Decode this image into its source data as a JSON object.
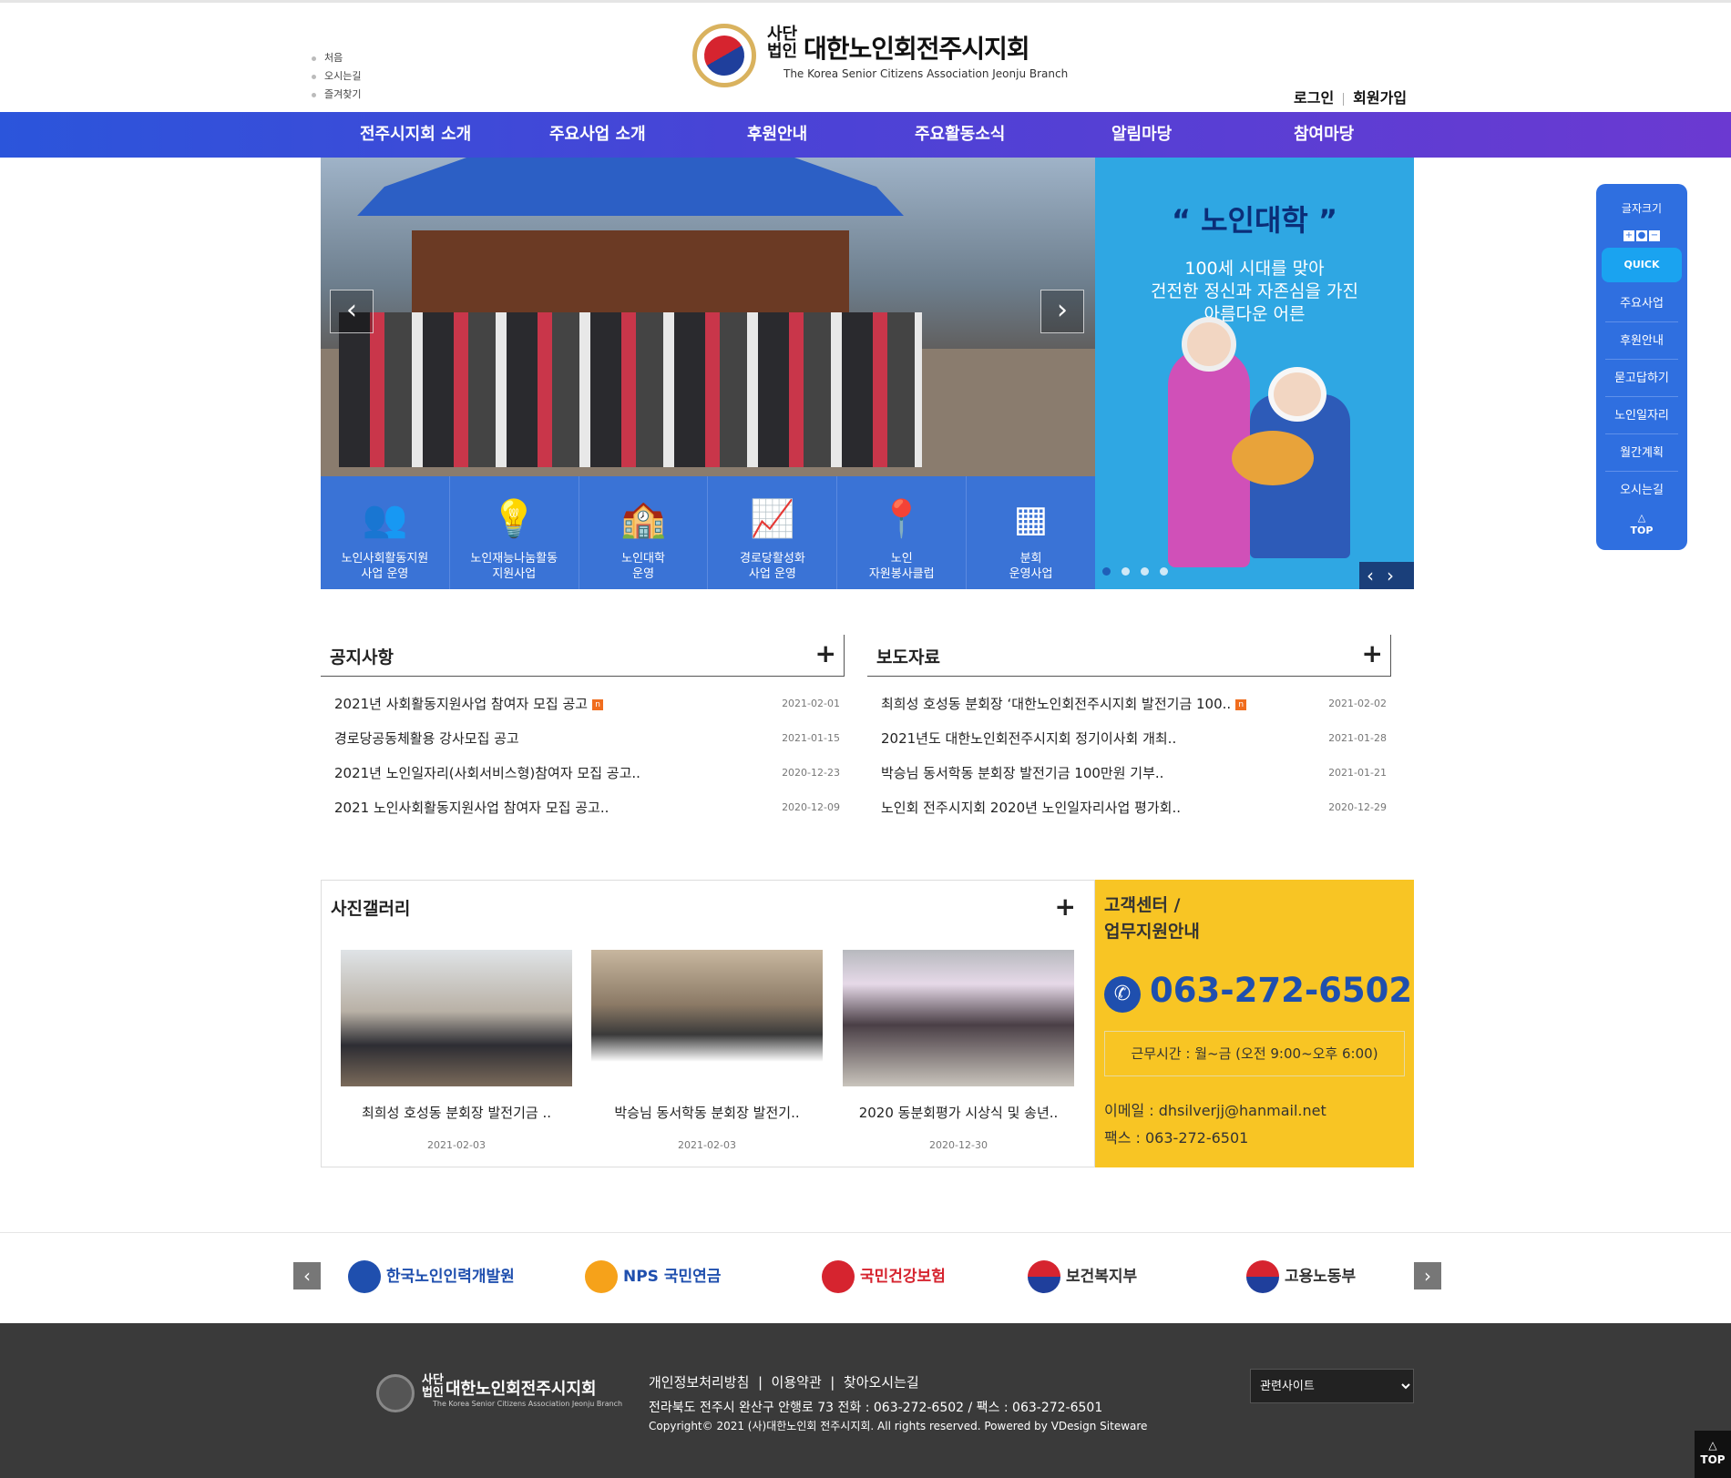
{
  "utility_links": [
    "처음",
    "오시는길",
    "즐겨찾기"
  ],
  "logo": {
    "small": "사단\n법인",
    "name": "대한노인회전주시지회",
    "english": "The Korea Senior Citizens Association Jeonju Branch"
  },
  "auth": {
    "login": "로그인",
    "join": "회원가입"
  },
  "nav": [
    "전주시지회 소개",
    "주요사업 소개",
    "후원안내",
    "주요활동소식",
    "알림마당",
    "참여마당"
  ],
  "slider": {
    "prev": "‹",
    "next": "›"
  },
  "promo": {
    "quote": "“ 노인대학 ”",
    "text_lines": [
      "100세 시대를 맞아",
      "건전한 정신과 자존심을 가진",
      "아름다운 어른"
    ]
  },
  "quick_services": [
    {
      "icon": "people-icon",
      "line1": "노인사회활동지원",
      "line2": "사업 운영"
    },
    {
      "icon": "lightbulb-icon",
      "line1": "노인재능나눔활동",
      "line2": "지원사업"
    },
    {
      "icon": "school-icon",
      "line1": "노인대학",
      "line2": "운영"
    },
    {
      "icon": "growth-chart-icon",
      "line1": "경로당활성화",
      "line2": "사업 운영"
    },
    {
      "icon": "map-pin-icon",
      "line1": "노인",
      "line2": "자원봉사클럽"
    },
    {
      "icon": "org-chart-icon",
      "line1": "분회",
      "line2": "운영사업"
    }
  ],
  "quick_panel": {
    "font_size": "글자크기",
    "quick": "QUICK",
    "items": [
      "주요사업",
      "후원안내",
      "묻고답하기",
      "노인일자리",
      "월간계획",
      "오시는길"
    ],
    "top_arrow": "△",
    "top": "TOP"
  },
  "notice": {
    "title": "공지사항",
    "more": "+",
    "items": [
      {
        "title": "2021년 사회활동지원사업 참여자 모집 공고",
        "date": "2021-02-01",
        "new": "n"
      },
      {
        "title": "경로당공동체활용 강사모집 공고",
        "date": "2021-01-15"
      },
      {
        "title": "2021년 노인일자리(사회서비스형)참여자 모집 공고..",
        "date": "2020-12-23"
      },
      {
        "title": "2021 노인사회활동지원사업 참여자 모집 공고..",
        "date": "2020-12-09"
      }
    ]
  },
  "press": {
    "title": "보도자료",
    "more": "+",
    "items": [
      {
        "title": "최희성 호성동 분회장 ‘대한노인회전주시지회 발전기금 100..",
        "date": "2021-02-02",
        "new": "n"
      },
      {
        "title": "2021년도 대한노인회전주시지회 정기이사회 개최..",
        "date": "2021-01-28"
      },
      {
        "title": "박승님 동서학동 분회장 발전기금 100만원 기부..",
        "date": "2021-01-21"
      },
      {
        "title": "노인회 전주시지회 2020년 노인일자리사업 평가회..",
        "date": "2020-12-29"
      }
    ]
  },
  "gallery": {
    "title": "사진갤러리",
    "more": "+",
    "items": [
      {
        "caption": "최희성 호성동 분회장 발전기금 ..",
        "date": "2021-02-03"
      },
      {
        "caption": "박승님 동서학동 분회장 발전기..",
        "date": "2021-02-03"
      },
      {
        "caption": "2020 동분회평가 시상식 및 송년..",
        "date": "2020-12-30"
      }
    ]
  },
  "contact": {
    "title_line1": "고객센터 /",
    "title_line2": "업무지원안내",
    "phone": "063-272-6502",
    "hours": "근무시간 : 월~금 (오전 9:00~오후 6:00)",
    "email": "이메일 : dhsilverjj@hanmail.net",
    "fax": "팩스 : 063-272-6501"
  },
  "partners": {
    "prev": "‹",
    "next": "›",
    "items": [
      {
        "name": "한국노인인력개발원",
        "icon": "kordi-logo-icon",
        "color": "#1f4fae"
      },
      {
        "name": "NPS 국민연금",
        "icon": "nps-logo-icon",
        "color": "#1f4fae"
      },
      {
        "name": "국민건강보험",
        "icon": "nhis-logo-icon",
        "color": "#d6242f"
      },
      {
        "name": "보건복지부",
        "icon": "korea-gov-emblem-icon",
        "color": "#1f3f9c"
      },
      {
        "name": "고용노동부",
        "icon": "korea-gov-emblem-icon",
        "color": "#1f3f9c"
      }
    ]
  },
  "footer": {
    "logo_small": "사단\n법인",
    "logo_name": "대한노인회전주시지회",
    "logo_english": "The Korea Senior Citizens Association Jeonju Branch",
    "links": [
      "개인정보처리방침",
      "이용약관",
      "찾아오시는길"
    ],
    "address": "전라북도 전주시 완산구 안행로 73 전화 : 063-272-6502  /  팩스 : 063-272-6501",
    "copyright": "Copyright© 2021 (사)대한노인회 전주시지회. All rights reserved. Powered by VDesign Siteware",
    "related_site": "관련사이트"
  },
  "back_to_top": "TOP"
}
